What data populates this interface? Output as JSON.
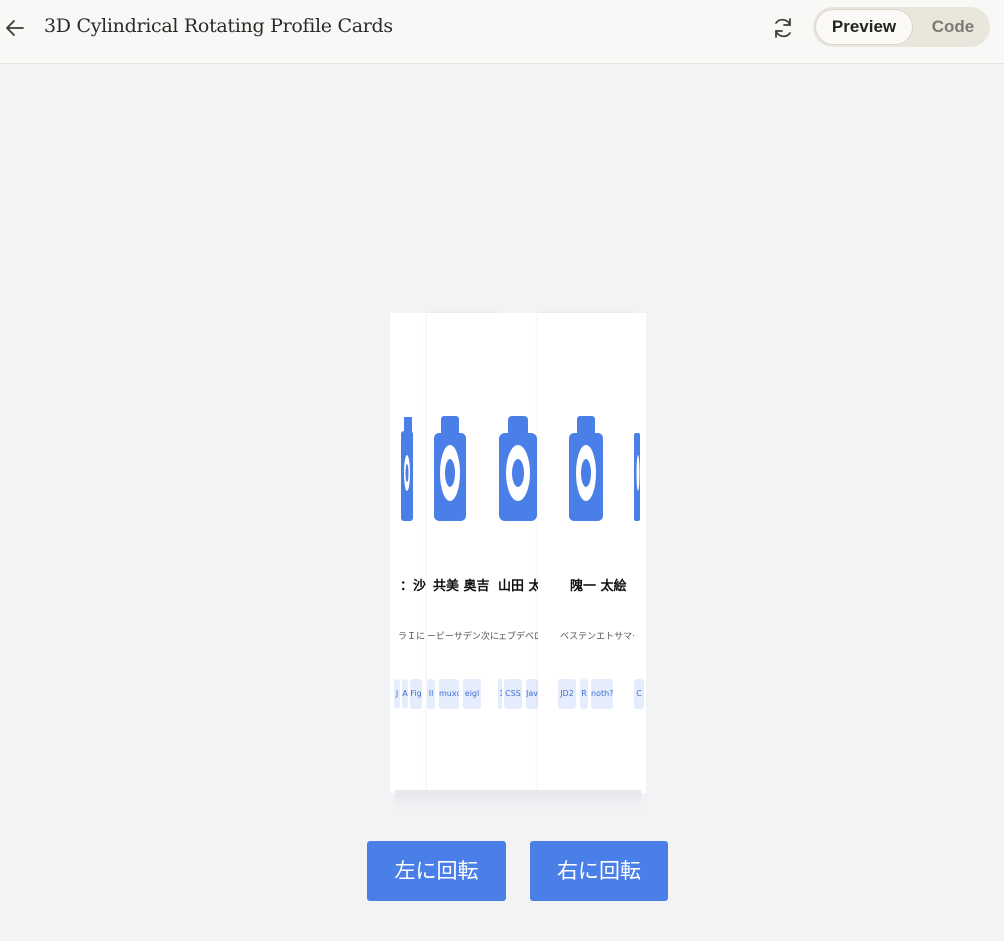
{
  "header": {
    "title": "3D Cylindrical Rotating Profile Cards",
    "toggle": {
      "preview_label": "Preview",
      "code_label": "Code",
      "selected": "Preview"
    }
  },
  "icons": {
    "back": "arrow-left-icon",
    "refresh": "refresh-icon",
    "avatar": "camera-icon"
  },
  "colors": {
    "accent": "#4a7fe8",
    "tag_bg": "#e5edfc",
    "tag_text": "#3e6fd8"
  },
  "cards": [
    {
      "name": "：沙",
      "role": "ラＩにＥ終",
      "tags": [
        "J",
        "A",
        "Fig"
      ]
    },
    {
      "name": "共美 奥吉",
      "role": "ービーサデン次にけて",
      "tags": [
        "Il",
        "muxd",
        "eigl"
      ]
    },
    {
      "name": "山田 太郎",
      "role": "ェブデベロッパー",
      "tags": [
        "Ｉ",
        "CSS",
        "Jav"
      ]
    },
    {
      "name": "隗一 太絵",
      "role": "ベステンエトサマーデ",
      "tags": [
        "JD2",
        "R",
        "noth?"
      ]
    },
    {
      "name": "",
      "role": "",
      "tags": [
        "C"
      ]
    }
  ],
  "buttons": {
    "rotate_left": "左に回転",
    "rotate_right": "右に回転"
  }
}
